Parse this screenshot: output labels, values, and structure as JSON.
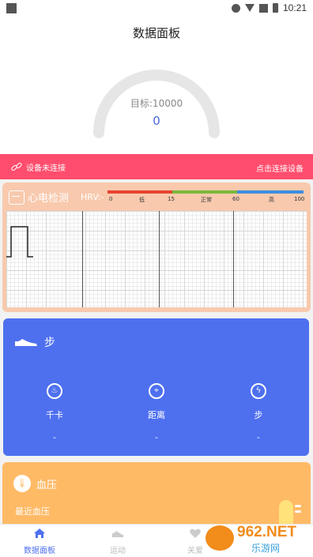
{
  "status_bar": {
    "time": "10:21"
  },
  "header": {
    "title": "数据面板"
  },
  "gauge": {
    "target_label": "目标:10000",
    "value": "0",
    "progress": 0
  },
  "connection": {
    "status": "设备未连接",
    "action": "点击连接设备"
  },
  "ecg": {
    "title": "心电检测",
    "hrv_label": "HRV:-",
    "scale": {
      "ticks": [
        "0",
        "低",
        "15",
        "正常",
        "60",
        "高",
        "100"
      ],
      "colors": [
        "#e8432f",
        "#7bb83a",
        "#3d8ee0"
      ]
    }
  },
  "steps": {
    "title": "步",
    "stats": [
      {
        "icon": "flame-icon",
        "label": "千卡",
        "value": "-"
      },
      {
        "icon": "location-pin-icon",
        "label": "距离",
        "value": "-"
      },
      {
        "icon": "bolt-icon",
        "label": "步",
        "value": "-"
      }
    ]
  },
  "blood_pressure": {
    "title": "血压",
    "recent_label": "最近血压"
  },
  "tabbar": {
    "tabs": [
      {
        "label": "数据面板"
      },
      {
        "label": "运动"
      },
      {
        "label": "关爱"
      }
    ]
  },
  "watermark": {
    "brand": "962.NET",
    "site": "乐游网"
  },
  "colors": {
    "accent": "#4e70ef",
    "alert": "#ff4d6d",
    "ecg_card": "#f8c9ad",
    "bp_card": "#ffba66"
  }
}
